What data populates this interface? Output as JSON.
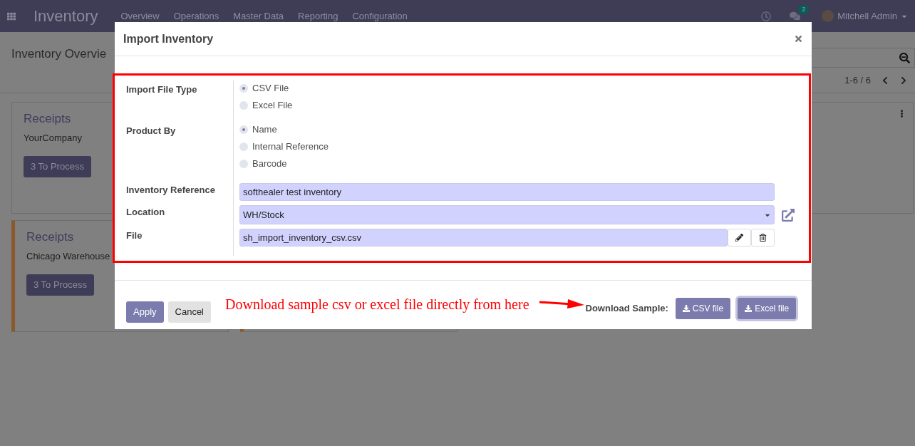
{
  "navbar": {
    "app_name": "Inventory",
    "menus": [
      "Overview",
      "Operations",
      "Master Data",
      "Reporting",
      "Configuration"
    ],
    "messages_badge": "2",
    "user": "Mitchell Admin"
  },
  "page": {
    "breadcrumb": "Inventory Overvie",
    "pager": "1-6 / 6"
  },
  "cards": [
    {
      "title": "Receipts",
      "subtitle": "YourCompany",
      "button": "3 To Process",
      "highlighted": false
    },
    {
      "title": "Receipts",
      "subtitle": "Chicago Warehouse",
      "button": "3 To Process",
      "highlighted": true
    }
  ],
  "dialog": {
    "title": "Import Inventory",
    "fields": [
      {
        "label": "Import File Type",
        "kind": "radio",
        "options": [
          {
            "label": "CSV File",
            "selected": true
          },
          {
            "label": "Excel File",
            "selected": false
          }
        ]
      },
      {
        "label": "Product By",
        "kind": "radio",
        "options": [
          {
            "label": "Name",
            "selected": true
          },
          {
            "label": "Internal Reference",
            "selected": false
          },
          {
            "label": "Barcode",
            "selected": false
          }
        ]
      },
      {
        "label": "Inventory Reference",
        "kind": "text",
        "value": "softhealer test inventory"
      },
      {
        "label": "Location",
        "kind": "select",
        "value": "WH/Stock"
      },
      {
        "label": "File",
        "kind": "file",
        "value": "sh_import_inventory_csv.csv"
      }
    ],
    "buttons": [
      {
        "label": "Apply",
        "primary": true
      },
      {
        "label": "Cancel",
        "primary": false
      }
    ],
    "annotation": "Download sample csv or excel file directly from here",
    "download_label": "Download Sample:",
    "download_buttons": [
      {
        "label": "CSV file",
        "focused": false
      },
      {
        "label": "Excel file",
        "focused": true
      }
    ]
  }
}
